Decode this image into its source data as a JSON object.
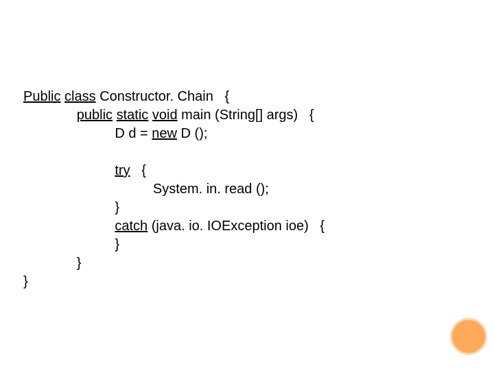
{
  "code": {
    "l1_kw1": "Public",
    "l1_kw2": "class",
    "l1_rest": " Constructor. Chain   {",
    "l2_indent": "              ",
    "l2_kw1": "public",
    "l2_kw2": "static",
    "l2_kw3": "void",
    "l2_rest": " main (String[] args)   {",
    "l3_indent": "                        D d = ",
    "l3_kw": "new",
    "l3_rest": " D ();",
    "l4": " ",
    "l5_indent": "                        ",
    "l5_kw": "try",
    "l5_rest": "   {",
    "l6": "                                  System. in. read ();",
    "l7": "                        }",
    "l8_indent": "                        ",
    "l8_kw": "catch",
    "l8_rest": " (java. io. IOException ioe)   {",
    "l9": "                        }",
    "l10": "              }",
    "l11": "}"
  }
}
